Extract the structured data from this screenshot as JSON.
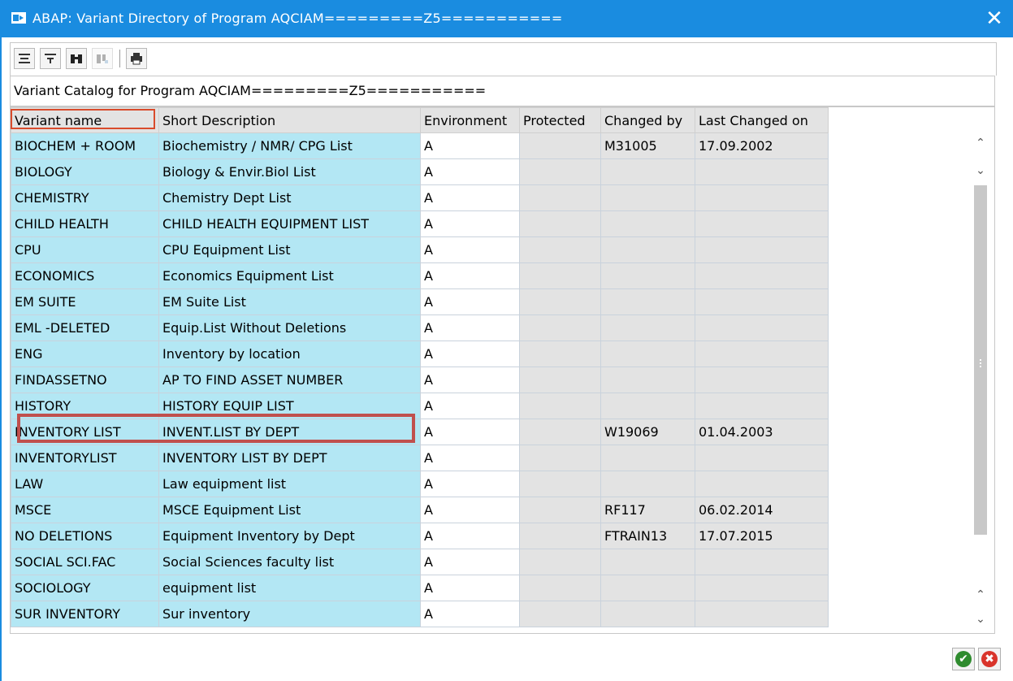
{
  "window": {
    "title": "ABAP: Variant Directory of Program AQCIAM=========Z5===========",
    "close_glyph": "✕"
  },
  "caption": "Variant Catalog for Program AQCIAM=========Z5===========",
  "table": {
    "headers": [
      "Variant name",
      "Short Description",
      "Environment",
      "Protected",
      "Changed by",
      "Last Changed on"
    ],
    "rows": [
      [
        "BIOCHEM + ROOM",
        "Biochemistry / NMR/ CPG List",
        "A",
        "",
        "M31005",
        "17.09.2002"
      ],
      [
        "BIOLOGY",
        "Biology & Envir.Biol List",
        "A",
        "",
        "",
        ""
      ],
      [
        "CHEMISTRY",
        "Chemistry Dept List",
        "A",
        "",
        "",
        ""
      ],
      [
        "CHILD HEALTH",
        "CHILD HEALTH EQUIPMENT LIST",
        "A",
        "",
        "",
        ""
      ],
      [
        "CPU",
        "CPU Equipment List",
        "A",
        "",
        "",
        ""
      ],
      [
        "ECONOMICS",
        "Economics Equipment List",
        "A",
        "",
        "",
        ""
      ],
      [
        "EM SUITE",
        "EM Suite List",
        "A",
        "",
        "",
        ""
      ],
      [
        "EML -DELETED",
        "Equip.List Without Deletions",
        "A",
        "",
        "",
        ""
      ],
      [
        "ENG",
        "Inventory by location",
        "A",
        "",
        "",
        ""
      ],
      [
        "FINDASSETNO",
        "AP TO FIND ASSET NUMBER",
        "A",
        "",
        "",
        ""
      ],
      [
        "HISTORY",
        "HISTORY EQUIP LIST",
        "A",
        "",
        "",
        ""
      ],
      [
        "INVENTORY LIST",
        "INVENT.LIST BY DEPT",
        "A",
        "",
        "W19069",
        "01.04.2003"
      ],
      [
        "INVENTORYLIST",
        "INVENTORY LIST BY DEPT",
        "A",
        "",
        "",
        ""
      ],
      [
        "LAW",
        "Law equipment list",
        "A",
        "",
        "",
        ""
      ],
      [
        "MSCE",
        "MSCE Equipment List",
        "A",
        "",
        "RF117",
        "06.02.2014"
      ],
      [
        "NO DELETIONS",
        "Equipment Inventory by Dept",
        "A",
        "",
        "FTRAIN13",
        "17.07.2015"
      ],
      [
        "SOCIAL SCI.FAC",
        "Social Sciences faculty list",
        "A",
        "",
        "",
        ""
      ],
      [
        "SOCIOLOGY",
        "equipment list",
        "A",
        "",
        "",
        ""
      ],
      [
        "SUR INVENTORY",
        "Sur inventory",
        "A",
        "",
        "",
        ""
      ]
    ]
  },
  "toolbar_icons": [
    "sort-ascending-icon",
    "filter-icon",
    "find-icon",
    "find-next-icon",
    "print-icon"
  ],
  "footer": {
    "ok_glyph": "✔",
    "cancel_glyph": "✖"
  },
  "colors": {
    "titlebar": "#1a8ce0",
    "key_column": "#b3e7f4",
    "data_column": "#e3e3e3",
    "highlight_box": "#c0504d",
    "ok_green": "#2e8b2e",
    "cancel_red": "#d9342b"
  }
}
